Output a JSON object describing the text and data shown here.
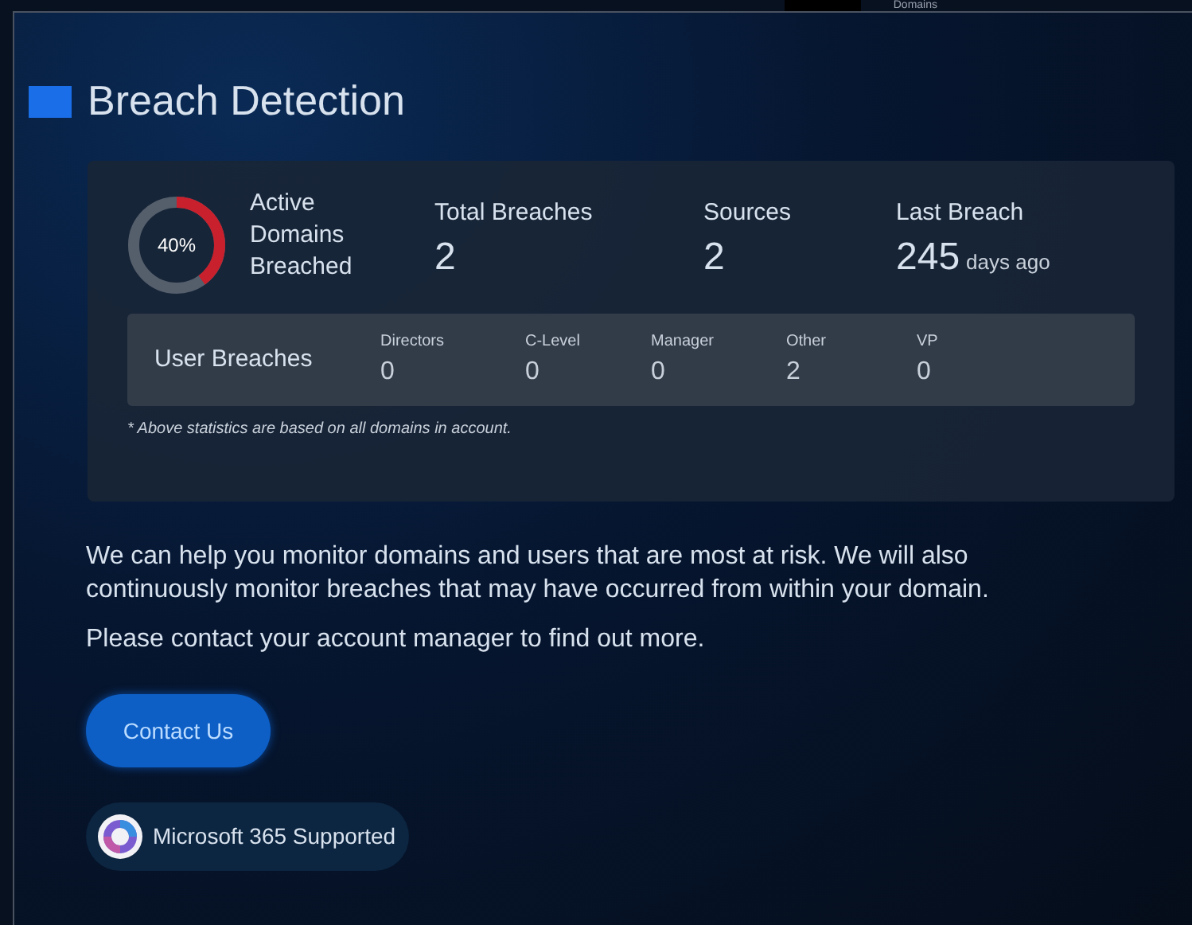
{
  "background_window": {
    "label": "Domains"
  },
  "title": "Breach Detection",
  "summary": {
    "meter": {
      "level": 0.4,
      "reading": "40%",
      "label": "Active Domains Breached"
    },
    "stats": [
      {
        "label": "Total Breaches",
        "value": "2"
      },
      {
        "label": "Sources",
        "value": "2"
      },
      {
        "label": "Last Breach",
        "value": "245",
        "unit": "days ago"
      }
    ],
    "user_breaches": {
      "label": "User Breaches",
      "groups": [
        {
          "label": "Directors",
          "value": "0"
        },
        {
          "label": "C-Level",
          "value": "0"
        },
        {
          "label": "Manager",
          "value": "0"
        },
        {
          "label": "Other",
          "value": "2"
        },
        {
          "label": "VP",
          "value": "0"
        }
      ]
    },
    "footnote": "* Above statistics are based on all domains in account."
  },
  "paragraphs": [
    "We can help you monitor domains and users that are most at risk. We will also continuously monitor breaches that may have occurred from within your domain.",
    "Please contact your account manager to find out more."
  ],
  "button": "Contact Us",
  "badge": "Microsoft 365 Supported"
}
